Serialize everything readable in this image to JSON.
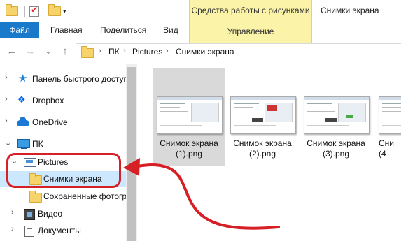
{
  "quick_access": {
    "properties_icon": "properties-check-icon",
    "folder_icon": "new-folder-icon",
    "dropdown": "▾"
  },
  "ribbon": {
    "context_group_title": "Средства работы с рисунками",
    "window_title": "Снимки экрана",
    "tabs": {
      "file": "Файл",
      "home": "Главная",
      "share": "Поделиться",
      "view": "Вид",
      "manage": "Управление"
    }
  },
  "navigation": {
    "back": "←",
    "forward": "→",
    "recent": "⌄",
    "up": "↑"
  },
  "address": {
    "crumbs": [
      "ПК",
      "Pictures",
      "Снимки экрана"
    ],
    "separator": "›"
  },
  "tree": {
    "quick_access": "Панель быстрого доступа",
    "dropbox": "Dropbox",
    "onedrive": "OneDrive",
    "pc": "ПК",
    "pictures": "Pictures",
    "screenshots": "Снимки экрана",
    "saved_photos": "Сохраненные фотогр",
    "video": "Видео",
    "documents": "Документы",
    "expand_closed": "›",
    "expand_open": "⌄"
  },
  "files": [
    {
      "line1": "Снимок экрана",
      "line2": "(1).png"
    },
    {
      "line1": "Снимок экрана",
      "line2": "(2).png"
    },
    {
      "line1": "Снимок экрана",
      "line2": "(3).png"
    },
    {
      "line1": "Сни",
      "line2": "(4"
    }
  ],
  "colors": {
    "file_tab": "#1979ca",
    "context_group": "#fbf3a8",
    "annotation": "#d71f26",
    "selection": "#cce8ff"
  }
}
